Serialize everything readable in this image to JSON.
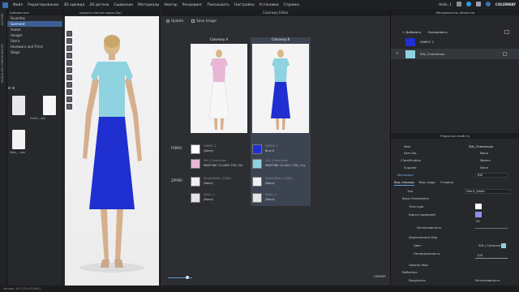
{
  "menubar": {
    "items": [
      "Файл",
      "Редактирование",
      "3D одежда",
      "2D детали",
      "Сшивание",
      "Материалы",
      "Аватар",
      "Рендеринг",
      "Показывать",
      "Настройка",
      "Установки",
      "Справка"
    ],
    "user": "Hello, 1",
    "brand": "COLORWAY"
  },
  "left_strip": {
    "history": "HISTORY",
    "modular": "MODULAR CONFIGURATOR"
  },
  "library": {
    "title": "Библиотека",
    "items": [
      "Favorites",
      "Garment",
      "Avatar",
      "Hanger",
      "Fabric",
      "Hardware and Trims",
      "Stage"
    ],
    "selected_index": 1,
    "thumbs": [
      {
        "label": "Fem&...ubs"
      },
      {
        "label": ""
      },
      {
        "label": "Male_...ubs"
      }
    ]
  },
  "viewport": {
    "tab": "модель платье новое.Zprj"
  },
  "editor": {
    "title": "Colorway Editor",
    "update": "Update",
    "save_image": "Save Image",
    "colorway_a": "Colorway A",
    "colorway_b": "Colorway B",
    "fabric_label": "FABRIC",
    "zipper_label": "ZIPPER",
    "a_rows": [
      {
        "t1": "FABRIC 2",
        "t2": "(None)",
        "color": "#ffffff"
      },
      {
        "t1": "Silk_Charmeuse",
        "t2": "PANTONE 13-2820 TSX | Pa",
        "color": "#e9b6d6"
      },
      {
        "t1": "ZipperTeeth_31584",
        "t2": "(None)",
        "color": "#f0f0f0"
      },
      {
        "t1": "Slider_1",
        "t2": "(None)",
        "color": "#e4e4e4"
      }
    ],
    "b_rows": [
      {
        "t1": "FABRIC 2",
        "t2": "Blue 6",
        "color": "#1f2fd0"
      },
      {
        "t1": "Silk_Charmeuse",
        "t2": "PANTONE 13-4411 TSX | Cry",
        "color": "#8fd2e0"
      },
      {
        "t1": "ZipperTeeth_31584",
        "t2": "(None)",
        "color": "#f0f0f0"
      },
      {
        "t1": "Slider_1",
        "t2": "(None)",
        "color": "#e4e4e4"
      }
    ],
    "viewer": "VIEWER"
  },
  "object_browser": {
    "title": "Обозреватель объектов",
    "add": "Добавить",
    "copy": "Копировать",
    "items": [
      {
        "name": "FABRIC 2",
        "color": "#1f2fd0"
      },
      {
        "name": "Silk_Charmeuse",
        "color": "#8fd2e0"
      }
    ]
  },
  "properties": {
    "title": "Редактор свойств",
    "name_label": "Имя",
    "name_value": "Silk_Charmeuse",
    "item_no_label": "Item No.",
    "item_no_value": "None",
    "classification_label": "Classification",
    "classification_value": "Woven",
    "supplier_label": "Supplier",
    "supplier_value": "None",
    "material_label": "Материал",
    "material_value": "RIB",
    "tabs": [
      "Вид спереди",
      "Вид сзади",
      "Сторона"
    ],
    "type_label": "Тип",
    "type_value": "Fabric_Matte",
    "basic_params": "Basic Parameters",
    "texture": "Текстура",
    "normal_map": "Карта нормалей",
    "normal_value": "50",
    "intensity": "Интенсивность",
    "displacement": "Displacement Map",
    "color_label": "Цвет",
    "color_value": "Silk | Carbonia",
    "opacity": "Непрозрачность",
    "opacity_value": "100",
    "opacity_map": "Opacity Map",
    "reflection": "Reflection",
    "roughness": "Roughness",
    "roughness_intensity": "Интенсивность"
  },
  "statusbar": {
    "version": "Version: 6.3.279 (r31061)"
  },
  "colors": {
    "accent": "#3b5f94",
    "dress_blue": "#1f2fd0",
    "top_cyan": "#8fd2e0",
    "pink": "#e9b6d6"
  }
}
